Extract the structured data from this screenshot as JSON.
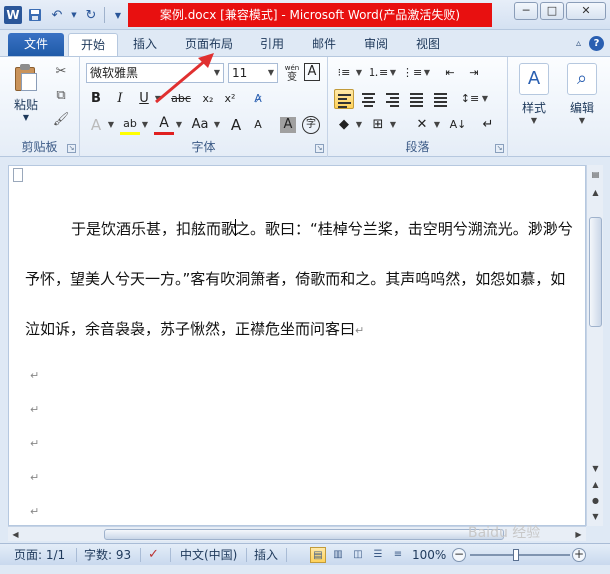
{
  "window": {
    "title": "案例.docx [兼容模式] - Microsoft Word(产品激活失败)",
    "app_icon": "W",
    "qat": [
      "save-icon",
      "undo-icon",
      "redo-icon",
      "customize-qat-icon"
    ],
    "controls": {
      "minimize": "─",
      "maximize": "□",
      "close": "✕"
    }
  },
  "tabs": {
    "file": "文件",
    "items": [
      "开始",
      "插入",
      "页面布局",
      "引用",
      "邮件",
      "审阅",
      "视图"
    ],
    "active": "开始"
  },
  "ribbon": {
    "clipboard": {
      "label": "剪贴板",
      "paste": "粘贴"
    },
    "font": {
      "label": "字体",
      "font_name": "微软雅黑",
      "font_size": "11",
      "wen": "wén",
      "bold": "B",
      "italic": "I",
      "underline": "U",
      "strikethrough": "abc",
      "subscript": "x₂",
      "superscript": "x²",
      "font_color_letter": "A",
      "grow": "A",
      "shrink": "A",
      "case": "Aa",
      "char_border": "A",
      "char_shading": "A",
      "enclosed": "字"
    },
    "paragraph": {
      "label": "段落"
    },
    "styles": {
      "label": "样式"
    },
    "editing": {
      "label": "编辑"
    }
  },
  "document": {
    "line1_before_cursor": "于是饮酒乐甚，扣舷而歌",
    "line1_after_cursor": "之。歌曰：“桂棹兮兰桨，击空明兮溯流光。渺渺兮",
    "line2": "予怀，望美人兮天一方。”客有吹洞箫者，倚歌而和之。其声呜呜然，如怨如慕，如",
    "line3": "泣如诉，余音袅袅，苏子愀然，正襟危坐而问客曰",
    "paragraph_mark": "↵"
  },
  "statusbar": {
    "page": "页面: 1/1",
    "words": "字数: 93",
    "language": "中文(中国)",
    "insert_mode": "插入",
    "zoom": "100%",
    "zoom_value": 100,
    "watermark": "Baidu 经验"
  },
  "colors": {
    "title_red": "#e81010",
    "file_tab_blue": "#1f5aa8",
    "accent_red_arrow": "#e03030"
  }
}
